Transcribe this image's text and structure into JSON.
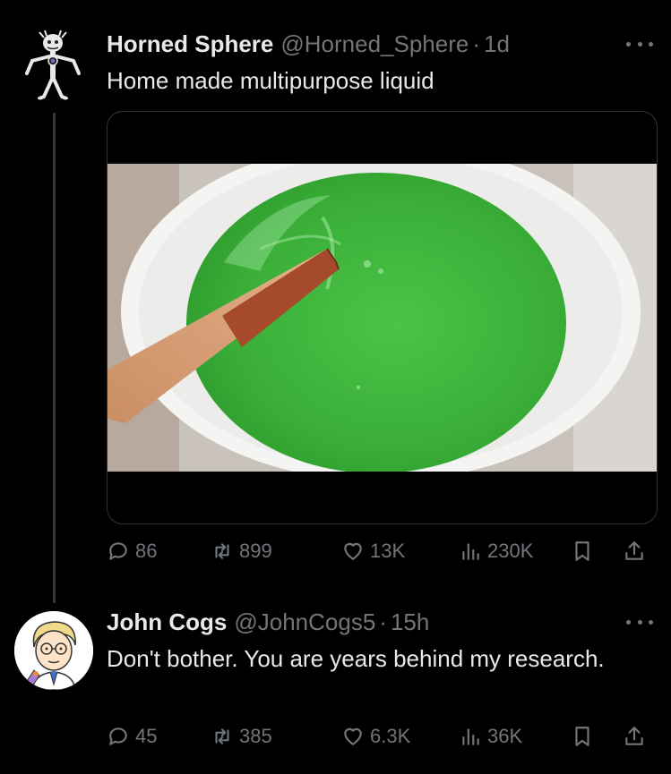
{
  "tweets": [
    {
      "display_name": "Horned Sphere",
      "handle": "@Horned_Sphere",
      "separator": "·",
      "time": "1d",
      "text": "Home made multipurpose liquid",
      "avatar_icon": "horned-figure-avatar",
      "media_description_icon": "green-liquid-bucket-photo",
      "stats": {
        "replies": "86",
        "retweets": "899",
        "likes": "13K",
        "views": "230K"
      }
    },
    {
      "display_name": "John Cogs",
      "handle": "@JohnCogs5",
      "separator": "·",
      "time": "15h",
      "text": "Don't bother. You are years behind my research.",
      "avatar_icon": "cartoon-scientist-avatar",
      "stats": {
        "replies": "45",
        "retweets": "385",
        "likes": "6.3K",
        "views": "36K"
      }
    }
  ],
  "colors": {
    "background": "#000000",
    "primary_text": "#e7e9ea",
    "secondary_text": "#71767b",
    "liquid_green": "#3db43a"
  }
}
